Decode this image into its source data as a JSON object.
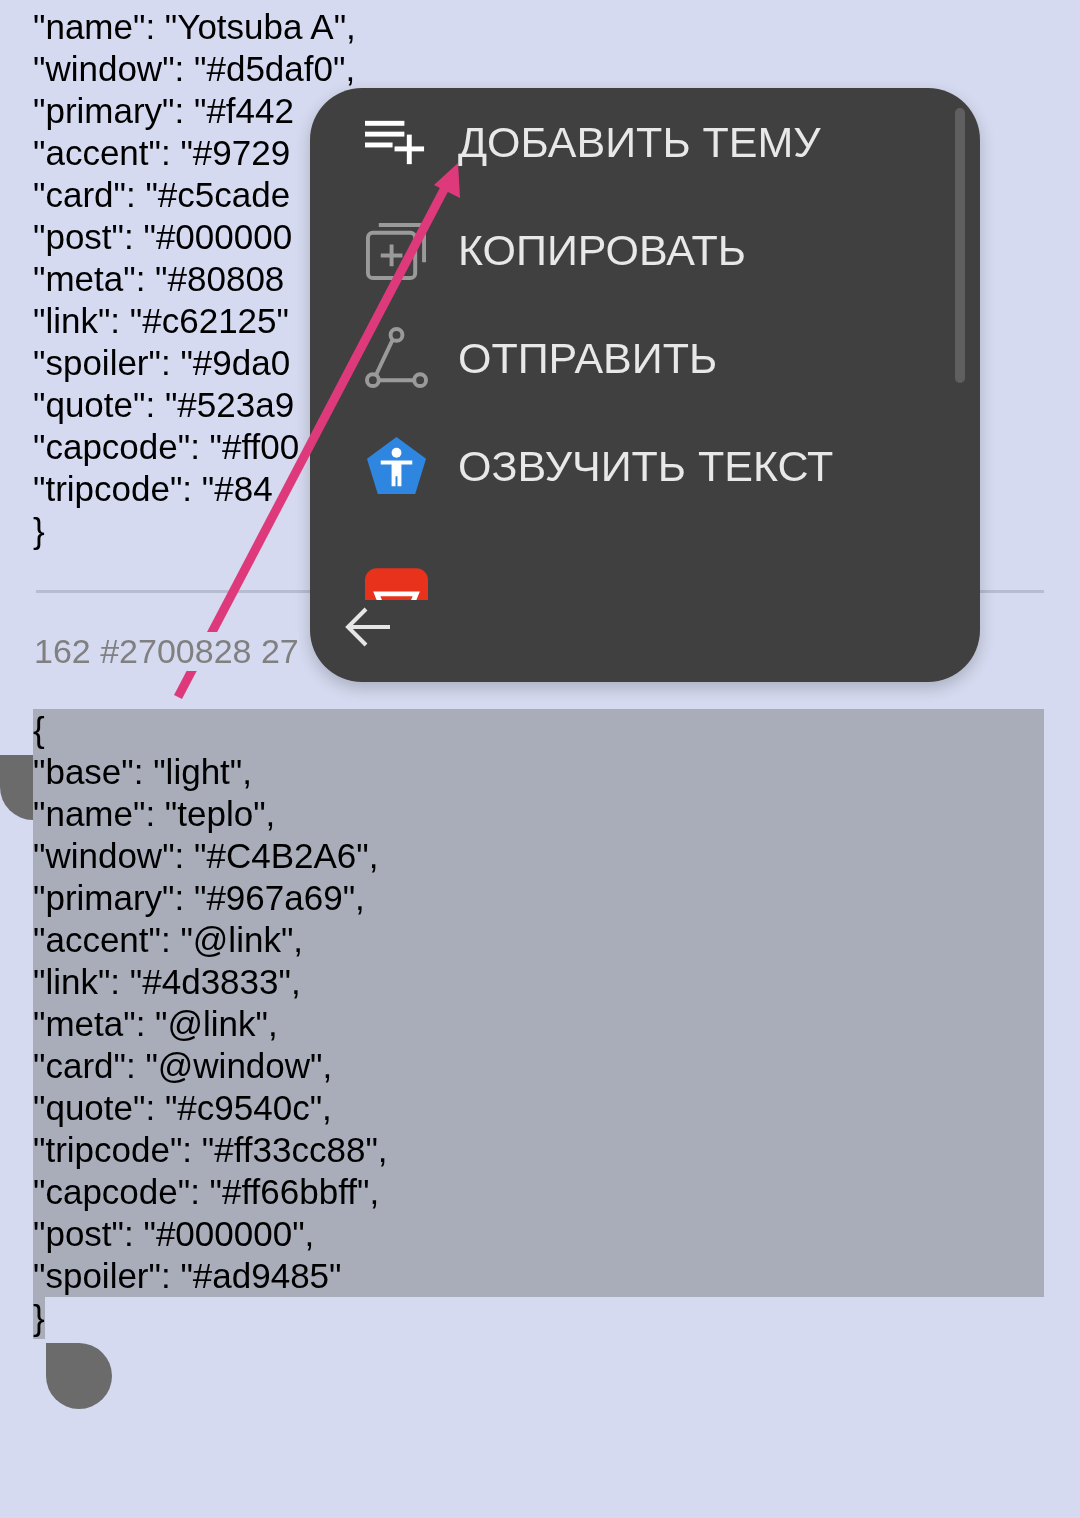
{
  "post_above": {
    "lines": [
      {
        "text": "\"name\": \"Yotsuba A\","
      },
      {
        "text": "\"window\": \"#d5daf0\","
      },
      {
        "text": "\"primary\": \"#f442"
      },
      {
        "text": "\"accent\": \"#9729"
      },
      {
        "text": "\"card\": \"#c5cade"
      },
      {
        "text": "\"post\": \"#000000"
      },
      {
        "text": "\"meta\": \"#80808"
      },
      {
        "text": "\"link\": \"#c62125\""
      },
      {
        "text": "\"spoiler\": \"#9da0"
      },
      {
        "text": "\"quote\": \"#523a9"
      },
      {
        "text": "\"capcode\": \"#ff00"
      },
      {
        "text": "\"tripcode\": \"#84"
      },
      {
        "text": "}"
      }
    ]
  },
  "post": {
    "meta": "162 #2700828 27",
    "lines": [
      {
        "text": "{",
        "selected": true
      },
      {
        "text": "\"base\": \"light\",",
        "selected": true
      },
      {
        "text": "\"name\": \"teplo\",",
        "selected": true
      },
      {
        "text": "\"window\": \"#C4B2A6\",",
        "selected": true
      },
      {
        "text": "\"primary\": \"#967a69\",",
        "selected": true
      },
      {
        "text": "\"accent\": \"@link\",",
        "selected": true
      },
      {
        "text": "\"link\": \"#4d3833\",",
        "selected": true
      },
      {
        "text": "\"meta\": \"@link\",",
        "selected": true
      },
      {
        "text": "\"card\": \"@window\",",
        "selected": true
      },
      {
        "text": "\"quote\": \"#c9540c\",",
        "selected": true
      },
      {
        "text": "\"tripcode\": \"#ff33cc88\",",
        "selected": true
      },
      {
        "text": "\"capcode\": \"#ff66bbff\",",
        "selected": true
      },
      {
        "text": "\"post\": \"#000000\",",
        "selected": true
      },
      {
        "text": "\"spoiler\": \"#ad9485\"",
        "selected": true
      },
      {
        "text": "}",
        "selected": true
      }
    ]
  },
  "context_menu": {
    "items": [
      {
        "kind": "entry",
        "label": "ДОБАВИТЬ ТЕМУ"
      },
      {
        "kind": "entry",
        "label": "КОПИРОВАТЬ"
      },
      {
        "kind": "entry",
        "label": "ОТПРАВИТЬ"
      },
      {
        "kind": "entry",
        "label": "ОЗВУЧИТЬ ТЕКСТ"
      },
      {
        "kind": "app"
      }
    ]
  }
}
